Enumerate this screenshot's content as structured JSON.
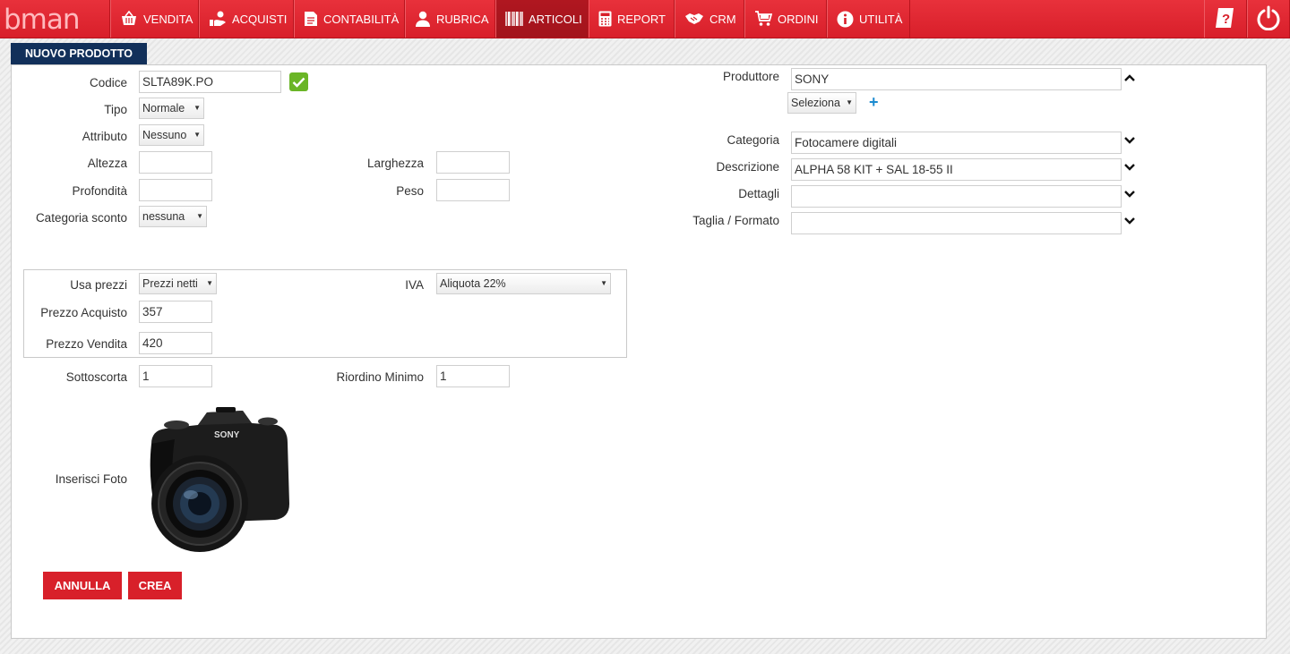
{
  "app": {
    "logo": "bman"
  },
  "nav": {
    "items": [
      {
        "id": "vendita",
        "label": "VENDITA",
        "icon": "basket-icon"
      },
      {
        "id": "acquisti",
        "label": "ACQUISTI",
        "icon": "hand-coin-icon"
      },
      {
        "id": "contabilita",
        "label": "CONTABILITÀ",
        "icon": "document-icon"
      },
      {
        "id": "rubrica",
        "label": "RUBRICA",
        "icon": "user-icon"
      },
      {
        "id": "articoli",
        "label": "ARTICOLI",
        "icon": "barcode-icon",
        "active": true
      },
      {
        "id": "report",
        "label": "REPORT",
        "icon": "calculator-icon"
      },
      {
        "id": "crm",
        "label": "CRM",
        "icon": "handshake-icon"
      },
      {
        "id": "ordini",
        "label": "ORDINI",
        "icon": "cart-icon"
      },
      {
        "id": "utilita",
        "label": "UTILITÀ",
        "icon": "info-icon"
      }
    ],
    "right_icons": [
      "help-icon",
      "power-icon"
    ]
  },
  "form": {
    "tab_title": "NUOVO PRODOTTO",
    "codice": {
      "label": "Codice",
      "value": "SLTA89K.PO"
    },
    "tipo": {
      "label": "Tipo",
      "value": "Normale"
    },
    "attributo": {
      "label": "Attributo",
      "value": "Nessuno"
    },
    "altezza": {
      "label": "Altezza",
      "value": ""
    },
    "larghezza": {
      "label": "Larghezza",
      "value": ""
    },
    "profondita": {
      "label": "Profondità",
      "value": ""
    },
    "peso": {
      "label": "Peso",
      "value": ""
    },
    "categoria_sconto": {
      "label": "Categoria sconto",
      "value": "nessuna"
    },
    "produttore": {
      "label": "Produttore",
      "value": "SONY",
      "select_label": "Seleziona"
    },
    "categoria": {
      "label": "Categoria",
      "value": "Fotocamere digitali"
    },
    "descrizione": {
      "label": "Descrizione",
      "value": "ALPHA 58 KIT + SAL 18-55 II"
    },
    "dettagli": {
      "label": "Dettagli",
      "value": ""
    },
    "taglia_formato": {
      "label": "Taglia / Formato",
      "value": ""
    },
    "usa_prezzi": {
      "label": "Usa prezzi",
      "value": "Prezzi netti"
    },
    "iva": {
      "label": "IVA",
      "value": "Aliquota 22%"
    },
    "prezzo_acquisto": {
      "label": "Prezzo Acquisto",
      "value": "357"
    },
    "prezzo_vendita": {
      "label": "Prezzo Vendita",
      "value": "420"
    },
    "sottoscorta": {
      "label": "Sottoscorta",
      "value": "1"
    },
    "riordino_minimo": {
      "label": "Riordino Minimo",
      "value": "1"
    },
    "foto": {
      "label": "Inserisci Foto",
      "brand_mark": "SONY"
    },
    "buttons": {
      "cancel": "ANNULLA",
      "create": "CREA"
    }
  },
  "colors": {
    "topbar": "#d81f2a",
    "active_tab": "#a2141c",
    "title_tab": "#12305a",
    "button": "#d8202a",
    "check": "#6ab526",
    "plus": "#1b8bd0"
  }
}
